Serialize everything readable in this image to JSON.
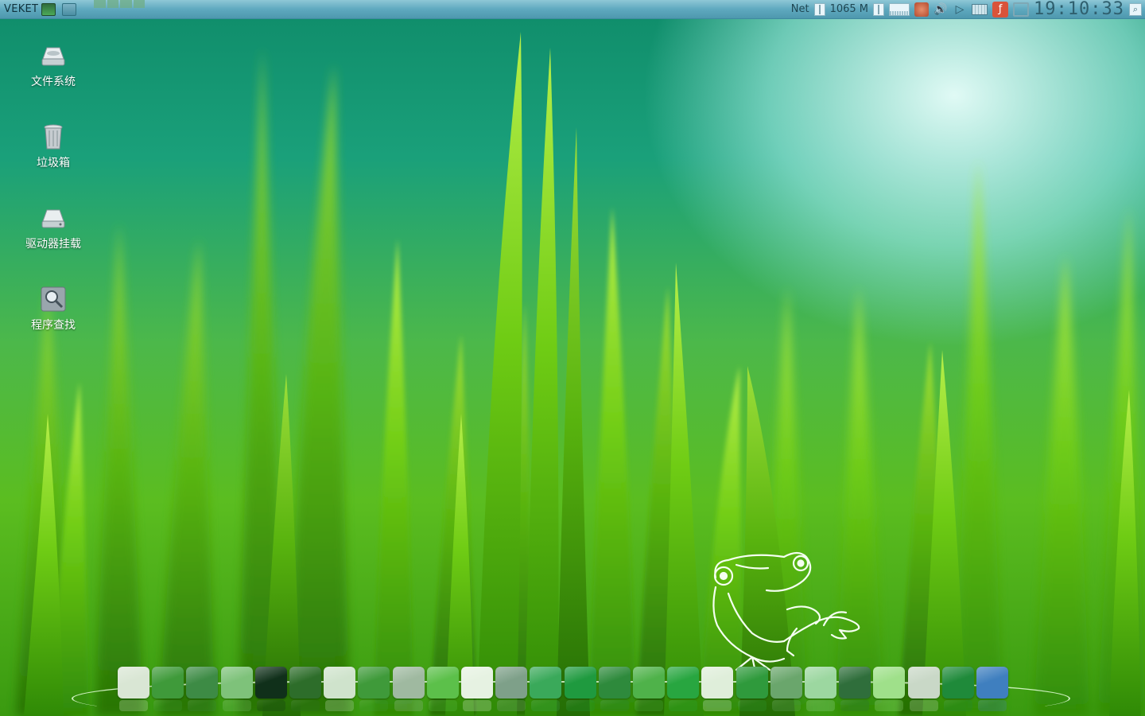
{
  "top_panel": {
    "menu_label": "VEKET",
    "net_label": "Net",
    "memory_text": "1065 M",
    "clock_text": "19:10:33"
  },
  "desktop_icons": [
    {
      "label": "文件系统",
      "icon": "hard-drive-icon"
    },
    {
      "label": "垃圾箱",
      "icon": "trash-icon"
    },
    {
      "label": "驱动器挂载",
      "icon": "drive-mount-icon"
    },
    {
      "label": "程序查找",
      "icon": "app-search-icon"
    }
  ],
  "dock": {
    "items": [
      {
        "name": "home-folder-icon",
        "color": "#d9e6d4"
      },
      {
        "name": "settings-gear-icon",
        "color": "#3f9a3a"
      },
      {
        "name": "display-monitor-icon",
        "color": "#3d8b45"
      },
      {
        "name": "spreadsheet-icon",
        "color": "#7ec27a"
      },
      {
        "name": "eye-viewer-icon",
        "color": "#10301a"
      },
      {
        "name": "leaf-brush-icon",
        "color": "#2d6d2a"
      },
      {
        "name": "keyboard-icon",
        "color": "#cfe3cc"
      },
      {
        "name": "paint-pencil-icon",
        "color": "#3f9a3a"
      },
      {
        "name": "camera-icon",
        "color": "#9fb9a0"
      },
      {
        "name": "leaf-app-icon",
        "color": "#5cc04a"
      },
      {
        "name": "pdf-document-icon",
        "color": "#e6f2e2"
      },
      {
        "name": "users-icon",
        "color": "#7ea089"
      },
      {
        "name": "browser-globe-icon",
        "color": "#3aa95a"
      },
      {
        "name": "network-disc-icon",
        "color": "#1f9a3f"
      },
      {
        "name": "editor-pen-icon",
        "color": "#2e8a3c"
      },
      {
        "name": "music-note-icon",
        "color": "#4fb24a"
      },
      {
        "name": "headphones-icon",
        "color": "#28a640"
      },
      {
        "name": "cd-disc-icon",
        "color": "#dfeeda"
      },
      {
        "name": "media-play-icon",
        "color": "#2f9a3c"
      },
      {
        "name": "magnifier-icon",
        "color": "#6aa66c"
      },
      {
        "name": "map-search-icon",
        "color": "#9cd7a0"
      },
      {
        "name": "photo-camera-icon",
        "color": "#2f6e3b"
      },
      {
        "name": "drive-green-icon",
        "color": "#9fe08a"
      },
      {
        "name": "sync-refresh-icon",
        "color": "#c9d8c7"
      },
      {
        "name": "power-button-icon",
        "color": "#1f8a3a"
      },
      {
        "name": "wallpaper-changer-icon",
        "color": "#3f7fbf"
      }
    ]
  }
}
